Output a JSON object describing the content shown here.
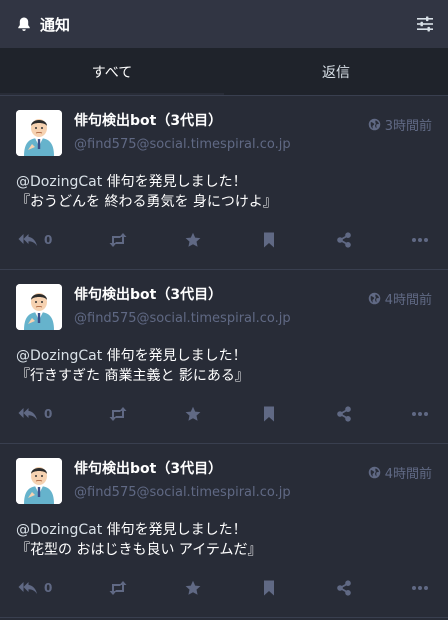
{
  "header": {
    "title": "通知",
    "icon": "bell-icon",
    "settings_icon": "sliders-icon"
  },
  "tabs": [
    {
      "label": "すべて",
      "active": true
    },
    {
      "label": "返信",
      "active": false
    }
  ],
  "notifications": [
    {
      "display_name": "俳句検出bot（3代目）",
      "acct": "@find575@social.timespiral.co.jp",
      "time": "3時間前",
      "mention": "@DozingCat",
      "line1": " 俳句を発見しました！",
      "line2": "『おうどんを 終わる勇気を 身につけよ』",
      "reply_count": "0"
    },
    {
      "display_name": "俳句検出bot（3代目）",
      "acct": "@find575@social.timespiral.co.jp",
      "time": "4時間前",
      "mention": "@DozingCat",
      "line1": " 俳句を発見しました！",
      "line2": "『行きすぎた 商業主義と 影にある』",
      "reply_count": "0"
    },
    {
      "display_name": "俳句検出bot（3代目）",
      "acct": "@find575@social.timespiral.co.jp",
      "time": "4時間前",
      "mention": "@DozingCat",
      "line1": " 俳句を発見しました！",
      "line2": "『花型の おはじきも良い アイテムだ』",
      "reply_count": "0"
    }
  ],
  "colors": {
    "background": "#282c37",
    "header": "#313543",
    "tabs": "#1f232b",
    "muted": "#606984"
  }
}
